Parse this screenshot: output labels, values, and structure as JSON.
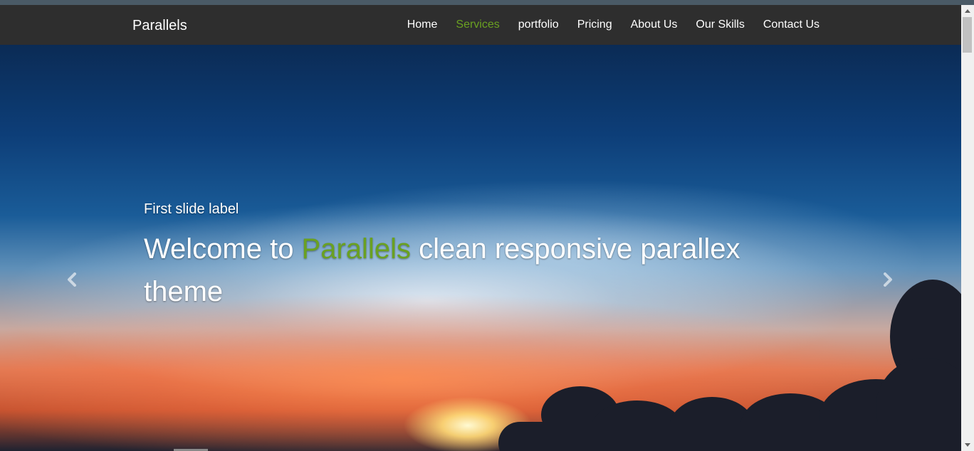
{
  "navbar": {
    "brand": "Parallels",
    "items": [
      {
        "label": "Home",
        "active": false
      },
      {
        "label": "Services",
        "active": true
      },
      {
        "label": "portfolio",
        "active": false
      },
      {
        "label": "Pricing",
        "active": false
      },
      {
        "label": "About Us",
        "active": false
      },
      {
        "label": "Our Skills",
        "active": false
      },
      {
        "label": "Contact Us",
        "active": false
      }
    ]
  },
  "carousel": {
    "label": "First slide label",
    "heading_pre": "Welcome to ",
    "heading_accent": "Parallels",
    "heading_post": " clean responsive parallex theme",
    "prev_icon": "chevron-left-icon",
    "next_icon": "chevron-right-icon"
  },
  "colors": {
    "accent": "#6aa121",
    "navbar_bg": "#2e2e2e",
    "text": "#ffffff"
  }
}
